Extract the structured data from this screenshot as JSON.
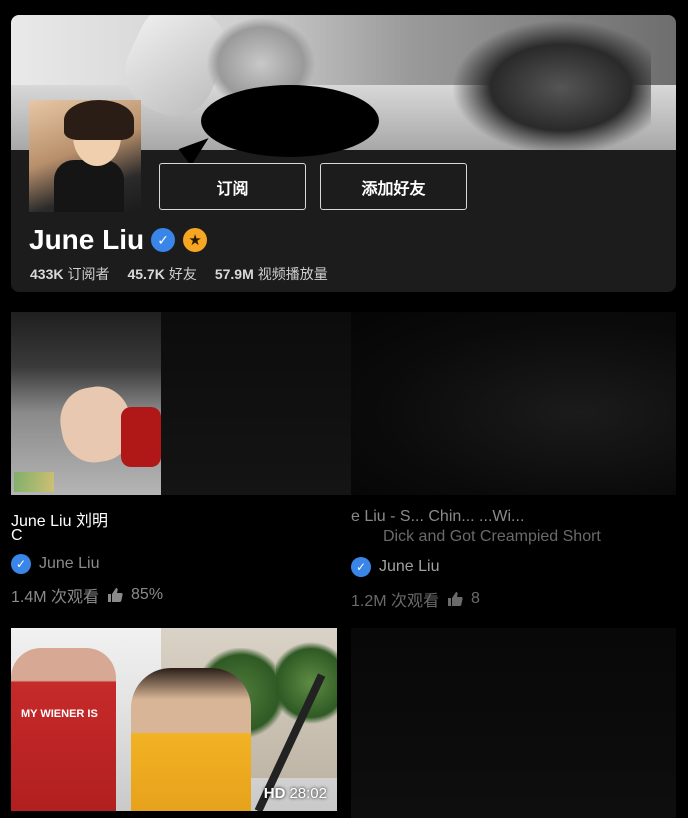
{
  "profile": {
    "name": "June Liu",
    "subscribe_label": "订阅",
    "add_friend_label": "添加好友",
    "stats": [
      {
        "value": "433K",
        "label": "订阅者"
      },
      {
        "value": "45.7K",
        "label": "好友"
      },
      {
        "value": "57.9M",
        "label": "视频播放量"
      }
    ],
    "verified_icon": "✓",
    "star_icon": "★"
  },
  "videos": [
    {
      "title_line1": "June Liu 刘明",
      "title_line2": "C",
      "author": "June Liu",
      "views": "1.4M 次观看",
      "rating": "85%"
    },
    {
      "title_line1": "e Liu - S... Chin... ...Wi...",
      "title_line2": "Dick and Got Creampied Short",
      "author": "June Liu",
      "views": "1.2M 次观看",
      "rating": "8"
    },
    {
      "hd_label": "HD",
      "duration": "28:02",
      "shirt_text": "MY WIENER IS"
    }
  ],
  "colors": {
    "background": "#000000",
    "card": "#1c1c1c",
    "verified_blue": "#3a86e8",
    "star_orange": "#f5a623"
  }
}
